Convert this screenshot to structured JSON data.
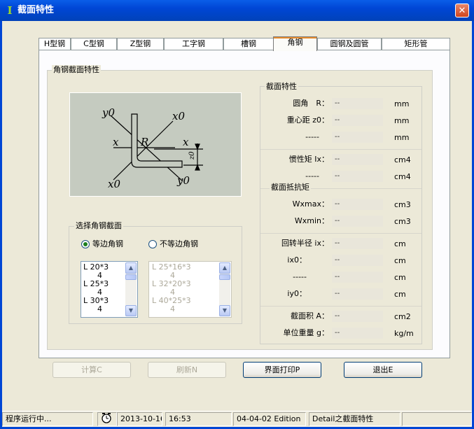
{
  "window": {
    "title": "截面特性",
    "close_glyph": "✕",
    "icon_glyph": "I"
  },
  "tabs": [
    {
      "label": "H型钢",
      "active": false
    },
    {
      "label": "C型钢",
      "active": false
    },
    {
      "label": "Z型钢",
      "active": false
    },
    {
      "label": "工字钢",
      "active": false
    },
    {
      "label": "槽钢",
      "active": false
    },
    {
      "label": "角钢",
      "active": true
    },
    {
      "label": "圆钢及圆管",
      "active": false
    },
    {
      "label": "矩形管",
      "active": false
    }
  ],
  "angle_section": {
    "group_title": "角钢截面特性",
    "diagram": {
      "y0_top": "y0",
      "x0_top": "x0",
      "x_left": "x",
      "x_right": "x",
      "R": "R",
      "z0": "z0",
      "x0_bottom": "x0",
      "y0_bottom": "y0"
    }
  },
  "select_section": {
    "group_title": "选择角钢截面",
    "equal_label": "等边角钢",
    "unequal_label": "不等边角钢",
    "equal_selected": true,
    "equal_list": [
      "L 20*3",
      "4",
      "L 25*3",
      "4",
      "L 30*3",
      "4"
    ],
    "unequal_list": [
      "L 25*16*3",
      "4",
      "L 32*20*3",
      "4",
      "L 40*25*3",
      "4"
    ]
  },
  "properties": {
    "group_title": "截面特性",
    "section_modulus_title": "截面抵抗矩",
    "rows": [
      {
        "label": "圆角　R：",
        "value": "--",
        "unit": "mm"
      },
      {
        "label": "重心距 z0：",
        "value": "--",
        "unit": "mm"
      },
      {
        "label": "-----",
        "value": "--",
        "unit": "mm"
      },
      {
        "label": "惯性矩 Ix：",
        "value": "--",
        "unit": "cm4"
      },
      {
        "label": "-----",
        "value": "--",
        "unit": "cm4"
      },
      {
        "label": "Wxmax：",
        "value": "--",
        "unit": "cm3"
      },
      {
        "label": "Wxmin：",
        "value": "--",
        "unit": "cm3"
      },
      {
        "label": "回转半径 ix：",
        "value": "--",
        "unit": "cm"
      },
      {
        "label": "ix0：",
        "value": "--",
        "unit": "cm"
      },
      {
        "label": "-----",
        "value": "--",
        "unit": "cm"
      },
      {
        "label": "iy0：",
        "value": "--",
        "unit": "cm"
      },
      {
        "label": "截面积 A：",
        "value": "--",
        "unit": "cm2"
      },
      {
        "label": "单位重量 g：",
        "value": "--",
        "unit": "kg/m"
      }
    ]
  },
  "buttons": {
    "calc": "计算C",
    "refresh": "刷新N",
    "print": "界面打印P",
    "exit": "退出E"
  },
  "statusbar": {
    "running": "程序运行中...",
    "date": "2013-10-16",
    "time": "16:53",
    "edition": "04-04-02 Edition",
    "detail": "Detail之截面特性"
  }
}
